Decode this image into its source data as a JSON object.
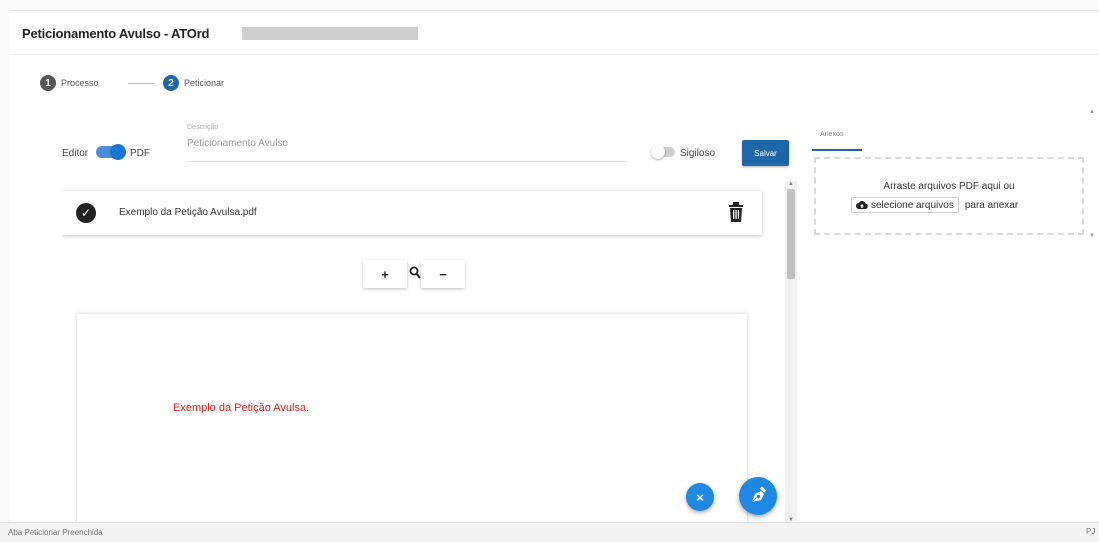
{
  "header": {
    "title": "Peticionamento Avulso - ATOrd"
  },
  "stepper": {
    "steps": [
      {
        "num": "1",
        "label": "Processo",
        "color": "#555555"
      },
      {
        "num": "2",
        "label": "Peticionar",
        "color": "#1e66a8"
      }
    ]
  },
  "toolbar": {
    "editor_label": "Editor",
    "pdf_label": "PDF",
    "description_label": "Descrição",
    "description_value": "Peticionamento Avulso",
    "sigiloso_label": "Sigiloso",
    "save_label": "Salvar"
  },
  "file": {
    "name": "Exemplo da Petição Avulsa.pdf"
  },
  "zoom": {
    "plus": "+",
    "minus": "−"
  },
  "pdf_preview": {
    "text": "Exemplo da Petição Avulsa."
  },
  "fab": {
    "cancel_label": "×"
  },
  "attachments": {
    "tab_label": "Anexos",
    "drop_text": "Arraste arquivos PDF aqui ou",
    "select_label": "selecione arquivos",
    "suffix_text": "para anexar"
  },
  "status_bar": {
    "text": "Aba Peticionar Preenchida",
    "right": "PJ"
  },
  "colors": {
    "accent": "#1e66a8",
    "fab": "#1e88e5",
    "pdf_text": "#e02020"
  }
}
